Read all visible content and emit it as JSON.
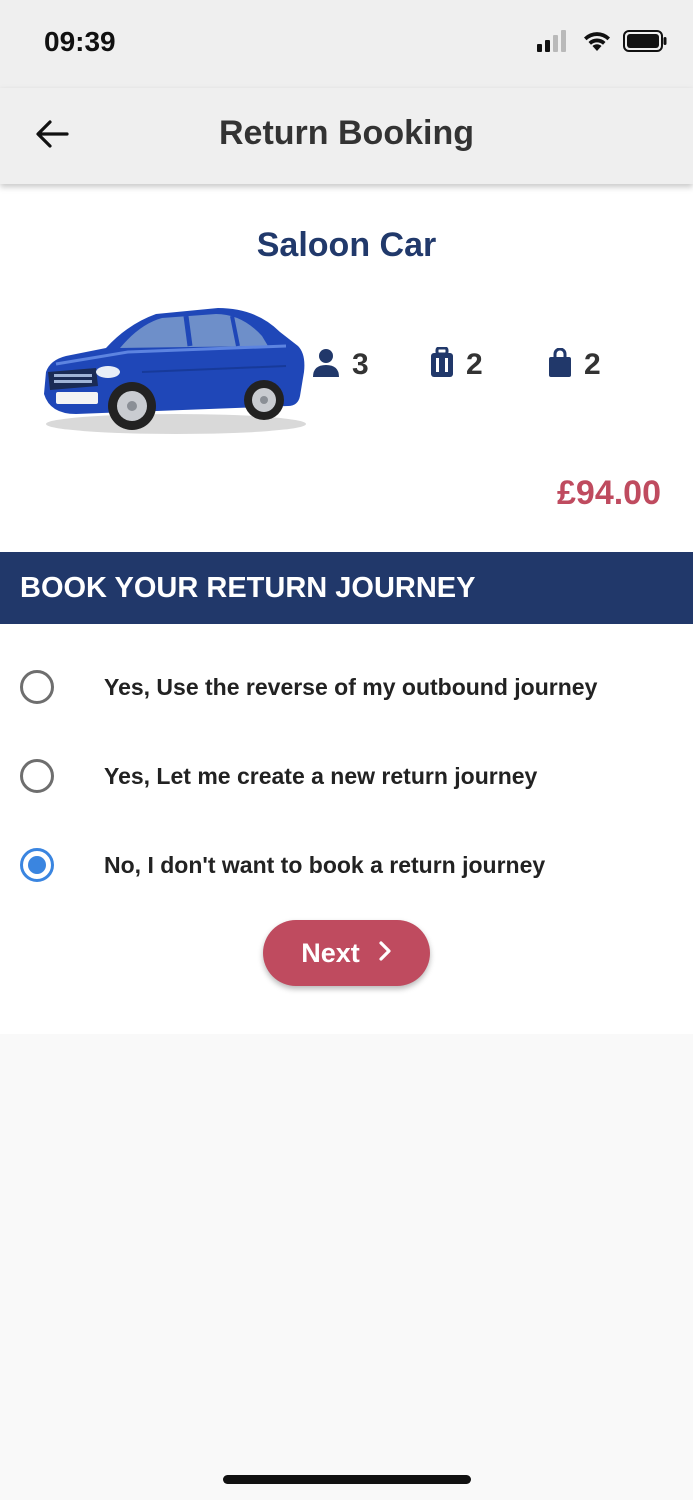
{
  "status_bar": {
    "time": "09:39",
    "icons": [
      "cellular-signal-icon",
      "wifi-icon",
      "battery-icon"
    ]
  },
  "header": {
    "title": "Return Booking",
    "back_icon": "back-arrow-icon"
  },
  "vehicle": {
    "name": "Saloon Car",
    "image": "blue-saloon-car",
    "passengers": "3",
    "luggage": "2",
    "hand_luggage": "2",
    "price": "£94.00"
  },
  "section": {
    "title": "BOOK YOUR RETURN JOURNEY"
  },
  "options": [
    {
      "label": "Yes, Use the reverse of my outbound journey",
      "selected": false
    },
    {
      "label": "Yes, Let me create a new return journey",
      "selected": false
    },
    {
      "label": "No, I don't want to book a return journey",
      "selected": true
    }
  ],
  "next_button": {
    "label": "Next",
    "icon": "chevron-right-icon"
  },
  "colors": {
    "brand_navy": "#21386a",
    "accent_red": "#bf4b5f",
    "radio_blue": "#3a85e0"
  }
}
